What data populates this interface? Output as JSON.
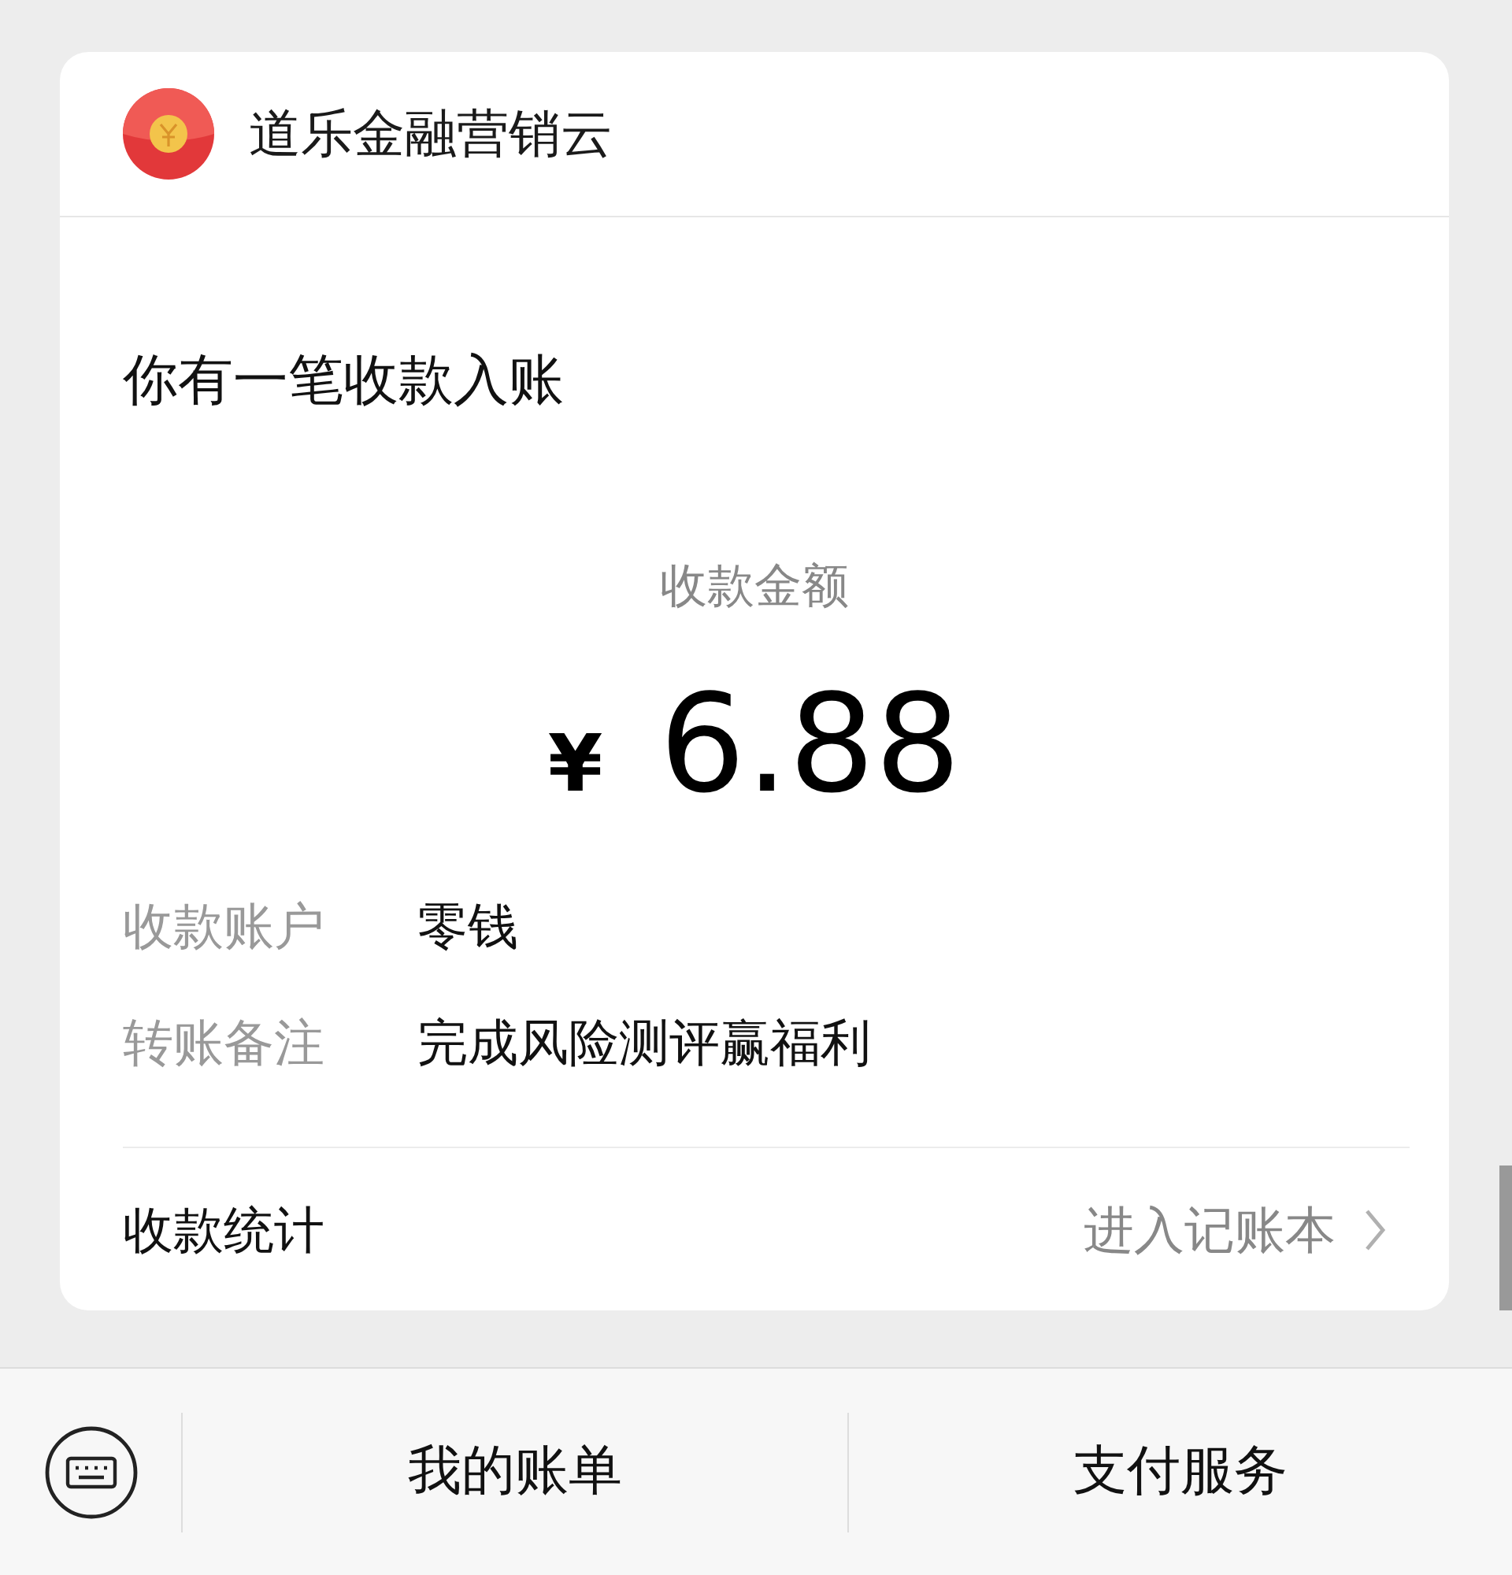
{
  "message": {
    "app_name": "道乐金融营销云",
    "heading": "你有一笔收款入账",
    "amount_label": "收款金额",
    "currency": "¥",
    "amount": "6.88",
    "details": [
      {
        "label": "收款账户",
        "value": "零钱"
      },
      {
        "label": "转账备注",
        "value": "完成风险测评赢福利"
      }
    ],
    "footer": {
      "label": "收款统计",
      "link": "进入记账本"
    }
  },
  "bottom_bar": {
    "items": [
      "我的账单",
      "支付服务"
    ]
  }
}
